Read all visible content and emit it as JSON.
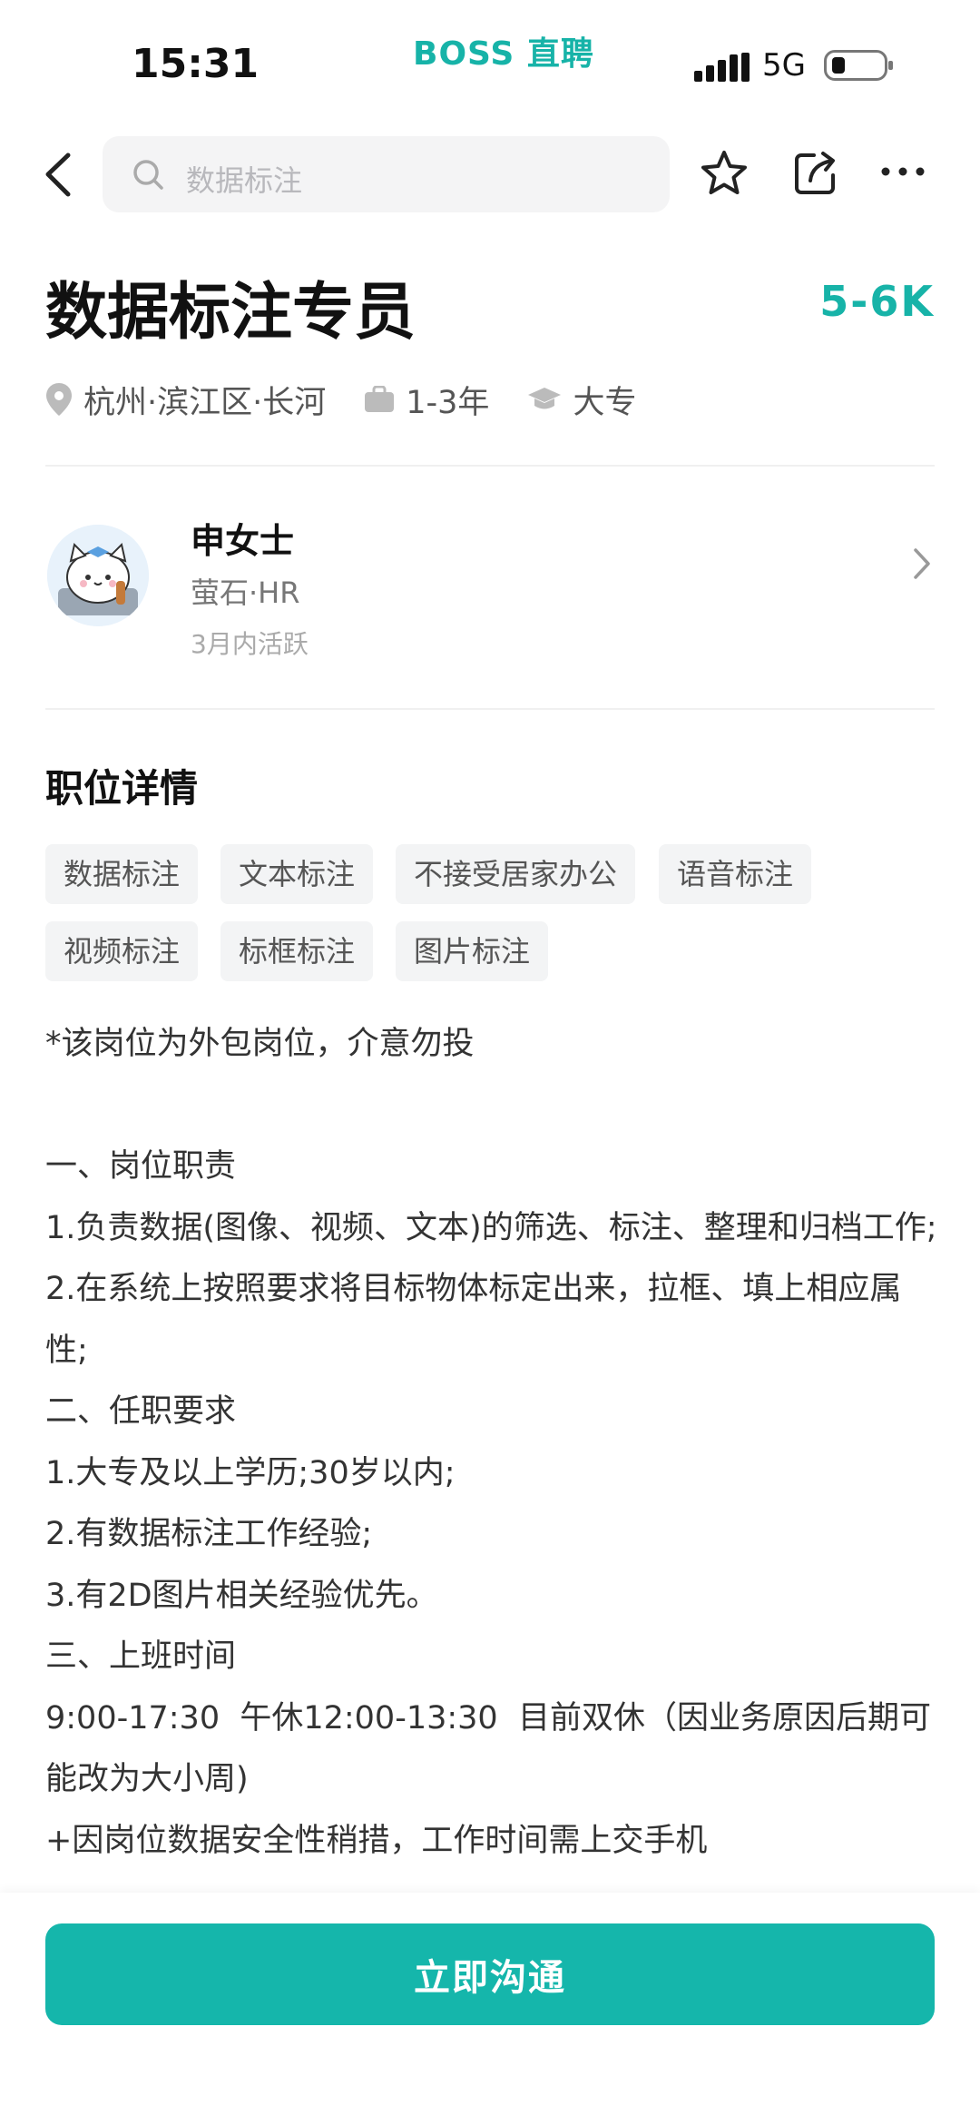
{
  "status_bar": {
    "time": "15:31",
    "brand": "BOSS 直聘",
    "network": "5G"
  },
  "nav": {
    "search_placeholder": "数据标注",
    "icons": [
      "back-icon",
      "search-icon",
      "star-icon",
      "share-icon",
      "more-icon"
    ]
  },
  "job": {
    "title": "数据标注专员",
    "salary": "5-6K",
    "location": "杭州·滨江区·长河",
    "experience": "1-3年",
    "education": "大专"
  },
  "recruiter": {
    "name": "申女士",
    "company": "萤石·HR",
    "activity": "3月内活跃"
  },
  "details": {
    "title": "职位详情",
    "tags": [
      "数据标注",
      "文本标注",
      "不接受居家办公",
      "语音标注",
      "视频标注",
      "标框标注",
      "图片标注"
    ],
    "description": [
      "*该岗位为外包岗位，介意勿投",
      "",
      "一、岗位职责",
      "1.负责数据(图像、视频、文本)的筛选、标注、整理和归档工作;",
      "2.在系统上按照要求将目标物体标定出来，拉框、填上相应属性;",
      "二、任职要求",
      "1.大专及以上学历;30岁以内;",
      "2.有数据标注工作经验;",
      "3.有2D图片相关经验优先。",
      "三、上班时间",
      "9:00-17:30  午休12:00-13:30  目前双休（因业务原因后期可能改为大小周)",
      "+因岗位数据安全性稍措，工作时间需上交手机"
    ]
  },
  "actions": {
    "chat_button": "立即沟通"
  },
  "colors": {
    "accent": "#17b3a8",
    "button": "#15b6ab"
  }
}
